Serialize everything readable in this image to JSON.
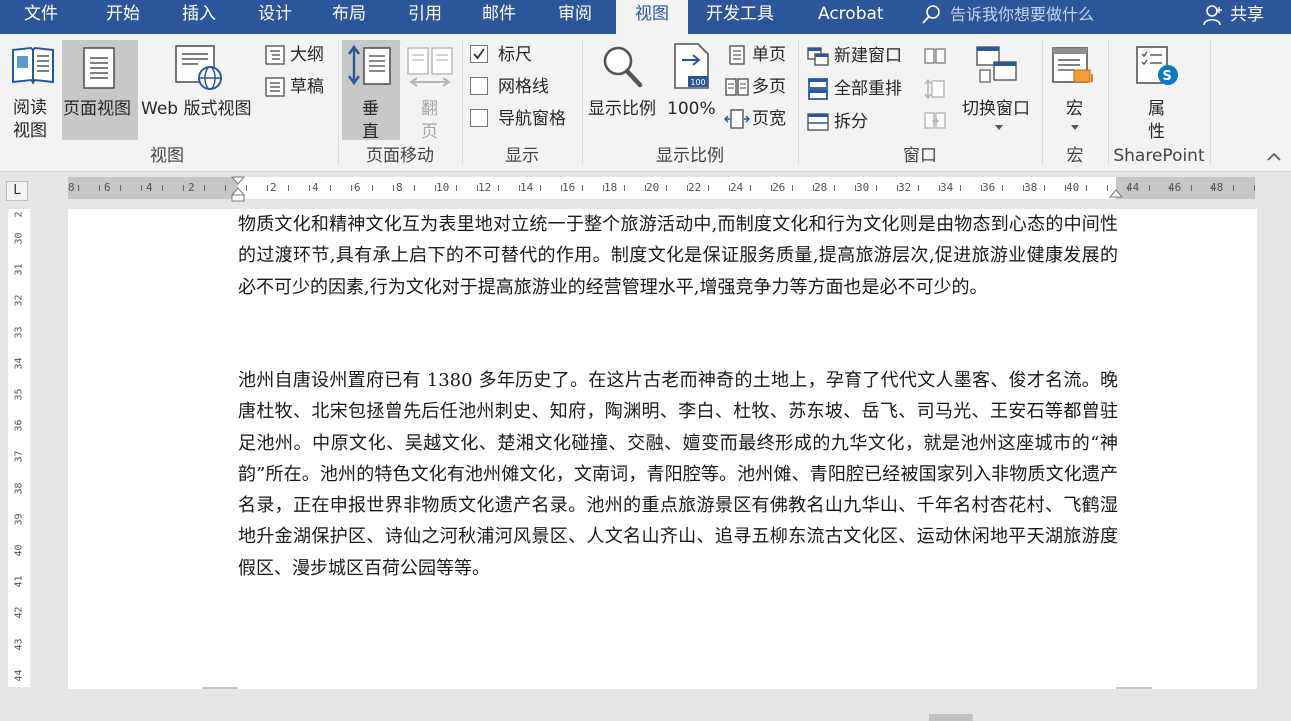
{
  "tabs": [
    "文件",
    "开始",
    "插入",
    "设计",
    "布局",
    "引用",
    "邮件",
    "审阅",
    "视图",
    "开发工具",
    "Acrobat"
  ],
  "active_tab": "视图",
  "tell_me": "告诉我你想要做什么",
  "share": "共享",
  "ribbon": {
    "views": {
      "read_mode": "阅读\n视图",
      "print_layout": "页面视图",
      "web_layout": "Web 版式视图",
      "outline": "大纲",
      "draft": "草稿",
      "label": "视图"
    },
    "page_movement": {
      "vertical": "垂\n直",
      "side_by_side": "翻\n页",
      "label": "页面移动"
    },
    "show": {
      "ruler": "标尺",
      "ruler_checked": true,
      "gridlines": "网格线",
      "gridlines_checked": false,
      "nav_pane": "导航窗格",
      "nav_pane_checked": false,
      "label": "显示"
    },
    "zoom": {
      "zoom": "显示比例",
      "hundred": "100%",
      "hundred_icon_text": "100",
      "one_page": "单页",
      "multi_page": "多页",
      "page_width": "页宽",
      "label": "显示比例"
    },
    "window": {
      "new_window": "新建窗口",
      "arrange_all": "全部重排",
      "split": "拆分",
      "switch_windows": "切换窗口",
      "label": "窗口"
    },
    "macros": {
      "macros": "宏",
      "label": "宏"
    },
    "sharepoint": {
      "properties": "属\n性",
      "label": "SharePoint"
    }
  },
  "ruler": {
    "tab_selector": "L",
    "numbers": [
      "8",
      "6",
      "4",
      "2",
      "2",
      "4",
      "6",
      "8",
      "10",
      "12",
      "14",
      "16",
      "18",
      "20",
      "22",
      "24",
      "26",
      "28",
      "30",
      "32",
      "34",
      "36",
      "38",
      "40",
      "44",
      "46",
      "48"
    ],
    "v_numbers": [
      "2",
      "30",
      "31",
      "32",
      "33",
      "34",
      "35",
      "36",
      "37",
      "38",
      "39",
      "40",
      "41",
      "42",
      "43",
      "44"
    ]
  },
  "document": {
    "para1": "物质文化和精神文化互为表里地对立统一于整个旅游活动中,而制度文化和行为文化则是由物态到心态的中间性的过渡环节,具有承上启下的不可替代的作用。制度文化是保证服务质量,提高旅游层次,促进旅游业健康发展的必不可少的因素,行为文化对于提高旅游业的经营管理水平,增强竞争力等方面也是必不可少的。",
    "para2": "池州自唐设州置府已有 1380 多年历史了。在这片古老而神奇的土地上，孕育了代代文人墨客、俊才名流。晚唐杜牧、北宋包拯曾先后任池州刺史、知府，陶渊明、李白、杜牧、苏东坡、岳飞、司马光、王安石等都曾驻足池州。中原文化、吴越文化、楚湘文化碰撞、交融、嬗变而最终形成的九华文化，就是池州这座城市的“神韵”所在。池州的特色文化有池州傩文化，文南词，青阳腔等。池州傩、青阳腔已经被国家列入非物质文化遗产名录，正在申报世界非物质文化遗产名录。池州的重点旅游景区有佛教名山九华山、千年名村杏花村、飞鹤湿地升金湖保护区、诗仙之河秋浦河风景区、人文名山齐山、追寻五柳东流古文化区、运动休闲地平天湖旅游度假区、漫步城区百荷公园等等。"
  },
  "colors": {
    "accent": "#2b579a",
    "ribbon_bg": "#f3f3f3",
    "selected": "#c8c8c8"
  }
}
